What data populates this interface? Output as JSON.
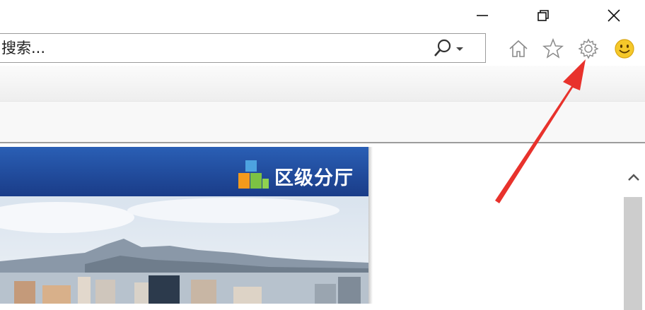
{
  "window_controls": {
    "minimize_icon": "minimize-icon",
    "restore_icon": "restore-icon",
    "close_icon": "close-icon"
  },
  "address_bar": {
    "placeholder": "搜索...",
    "search_icon": "search-icon",
    "dropdown_icon": "chevron-down-icon"
  },
  "toolbar": {
    "icons": [
      "home-icon",
      "favorites-star-icon",
      "gear-icon",
      "smiley-feedback-icon"
    ]
  },
  "page": {
    "banner_title": "区级分厅",
    "banner_colors": {
      "top": "#2a5fb5",
      "bottom": "#1a3c88"
    }
  },
  "annotation": {
    "arrow_color": "#e8322c",
    "points_to": "gear-icon"
  }
}
